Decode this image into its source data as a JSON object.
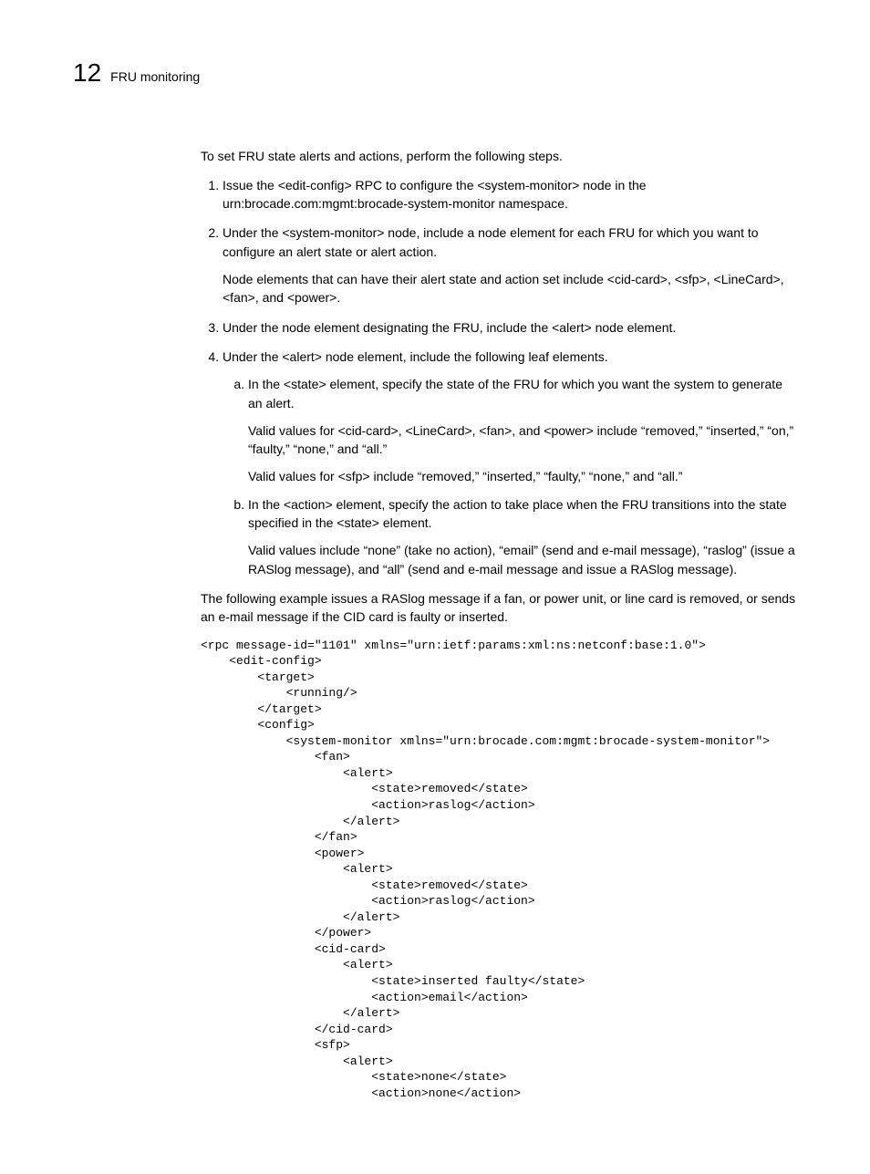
{
  "header": {
    "chapterNumber": "12",
    "chapterTitle": "FRU monitoring"
  },
  "intro": "To set FRU state alerts and actions, perform the following steps.",
  "steps": {
    "s1": "Issue the <edit-config> RPC to configure the <system-monitor> node in the urn:brocade.com:mgmt:brocade-system-monitor namespace.",
    "s2": "Under the <system-monitor> node, include a node element for each FRU for which you want to configure an alert state or alert action.",
    "s2_note": "Node elements that can have their alert state and action set include <cid-card>, <sfp>, <LineCard>, <fan>, and <power>.",
    "s3": "Under the node element designating the FRU, include the <alert> node element.",
    "s4": "Under the <alert> node element, include the following leaf elements.",
    "s4a": "In the <state> element, specify the state of the FRU for which you want the system to generate an alert.",
    "s4a_v1": "Valid values for <cid-card>, <LineCard>, <fan>, and <power> include “removed,” “inserted,” “on,” “faulty,” “none,” and “all.”",
    "s4a_v2": "Valid values for <sfp> include “removed,” “inserted,” “faulty,” “none,” and “all.”",
    "s4b": "In the <action> element, specify the action to take place when the FRU transitions into the state specified in the <state> element.",
    "s4b_v": "Valid values include “none” (take no action), “email” (send and e-mail message), “raslog” (issue a RASlog message), and “all” (send and e-mail message and issue a RASlog message)."
  },
  "exampleIntro": "The following example issues a RASlog message if a fan, or power unit, or line card is removed, or sends an e-mail message if the CID card is faulty or inserted.",
  "code": "<rpc message-id=\"1101\" xmlns=\"urn:ietf:params:xml:ns:netconf:base:1.0\">\n    <edit-config>\n        <target>\n            <running/>\n        </target>\n        <config>\n            <system-monitor xmlns=\"urn:brocade.com:mgmt:brocade-system-monitor\">\n                <fan>\n                    <alert>\n                        <state>removed</state>\n                        <action>raslog</action>\n                    </alert>\n                </fan>\n                <power>\n                    <alert>\n                        <state>removed</state>\n                        <action>raslog</action>\n                    </alert>\n                </power>\n                <cid-card>\n                    <alert>\n                        <state>inserted faulty</state>\n                        <action>email</action>\n                    </alert>\n                </cid-card>\n                <sfp>\n                    <alert>\n                        <state>none</state>\n                        <action>none</action>"
}
